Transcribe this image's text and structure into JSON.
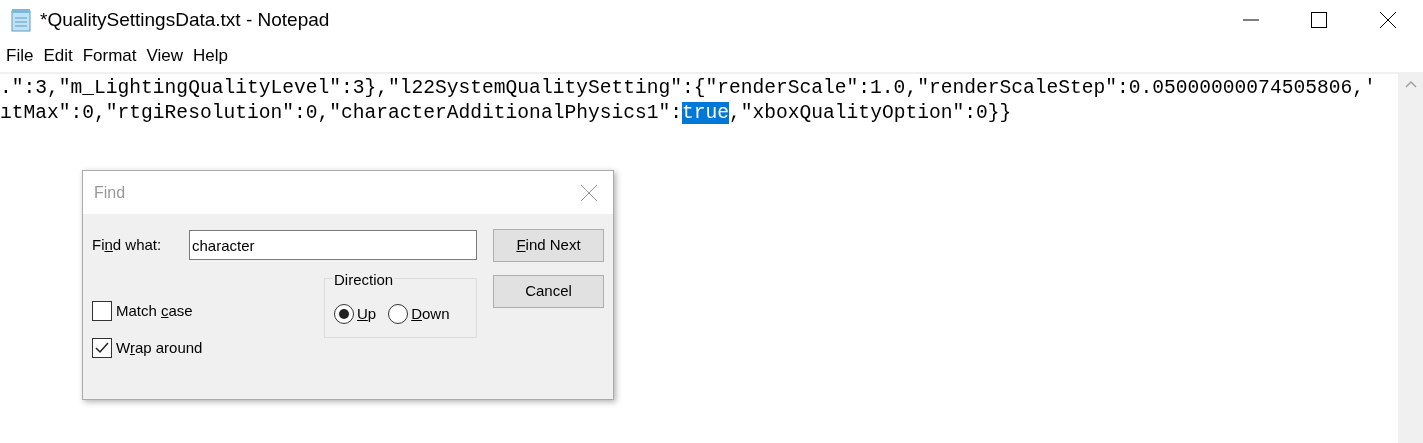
{
  "window": {
    "title": "*QualitySettingsData.txt - Notepad"
  },
  "menu": [
    "File",
    "Edit",
    "Format",
    "View",
    "Help"
  ],
  "editor": {
    "lines": [
      {
        "before": ".\":3,\"m_LightingQualityLevel\":3},\"l22SystemQualitySetting\":{\"renderScale\":1.0,\"renderScaleStep\":0.05000000074505806,'"
      },
      {
        "before": "ıtMax\":0,\"rtgiResolution\":0,\"characterAdditionalPhysics1\":",
        "selection": "true",
        "after": ",\"xboxQualityOption\":0}}"
      }
    ]
  },
  "find_dialog": {
    "title": "Find",
    "find_what": {
      "label": {
        "before": "Fi",
        "key": "n",
        "after": "d what:"
      },
      "value": "character"
    },
    "buttons": [
      {
        "label": {
          "key": "F",
          "after": "ind Next"
        }
      },
      {
        "label": {
          "before": "Cancel"
        }
      }
    ],
    "direction": {
      "title": "Direction",
      "options": [
        {
          "label": {
            "key": "U",
            "after": "p"
          },
          "selected": true
        },
        {
          "label": {
            "key": "D",
            "after": "own"
          },
          "selected": false
        }
      ]
    },
    "checkboxes": [
      {
        "label": {
          "before": "Match ",
          "key": "c",
          "after": "ase"
        },
        "checked": false
      },
      {
        "label": {
          "before": "W",
          "key": "r",
          "after": "ap around"
        },
        "checked": true
      }
    ]
  }
}
